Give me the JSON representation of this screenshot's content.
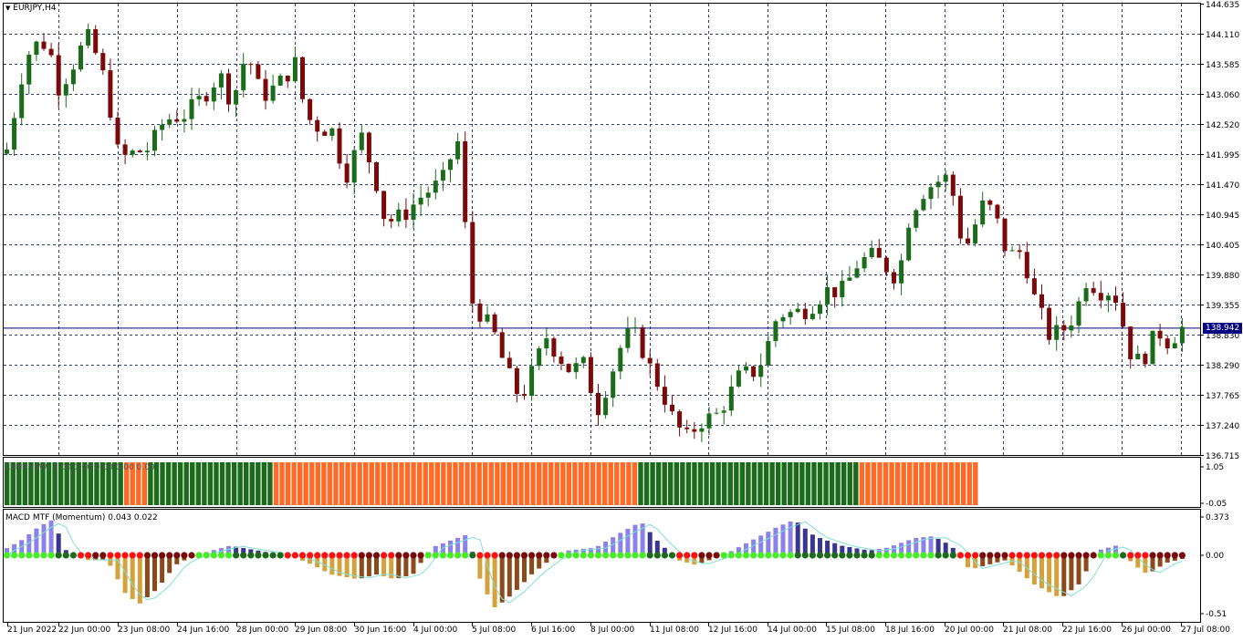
{
  "window": {
    "symbol_title": "EURJPY,H4",
    "menu_arrow_icon": "triangle-down-icon"
  },
  "colors": {
    "bull": "#1a6b1a",
    "bear": "#7a0a0a",
    "grid": "#2f3d6e",
    "bid_line": "#000080",
    "trend_green": "#1a6b1a",
    "trend_orange": "#ff6a26",
    "macd_pos_light": "#8a82e8",
    "macd_pos_dark": "#3a3590",
    "macd_neg_light": "#d4a23c",
    "macd_neg_dark": "#8a4a1a",
    "dot_bright_green": "#44ee22",
    "dot_dark_green": "#1a6b1a",
    "dot_red": "#ff1010",
    "dot_dark_red": "#7a0a0a",
    "signal_line": "#7fe0d0"
  },
  "price_axis": {
    "ticks": [
      "144.635",
      "144.110",
      "143.585",
      "143.060",
      "142.520",
      "141.995",
      "141.470",
      "140.945",
      "140.405",
      "139.880",
      "139.355",
      "138.830",
      "138.290",
      "137.765",
      "137.240",
      "136.715"
    ],
    "current_price": "138.942"
  },
  "time_axis": {
    "labels": [
      "21 Jun 2022",
      "22 Jun 00:00",
      "23 Jun 08:00",
      "24 Jun 16:00",
      "28 Jun 00:00",
      "29 Jun 08:00",
      "30 Jun 16:00",
      "4 Jul 00:00",
      "5 Jul 08:00",
      "6 Jul 16:00",
      "8 Jul 00:00",
      "11 Jul 08:00",
      "12 Jul 16:00",
      "14 Jul 00:00",
      "15 Jul 08:00",
      "18 Jul 16:00",
      "20 Jul 00:00",
      "21 Jul 08:00",
      "22 Jul 16:00",
      "26 Jul 00:00",
      "27 Jul 08:00"
    ]
  },
  "indicator1": {
    "label": "LSMA (SW) 1.00 1.00 0.00 0.00 0.00",
    "axis_ticks": [
      "1.05",
      "-0.05"
    ],
    "segments": [
      {
        "trend": "up",
        "bars": 20
      },
      {
        "trend": "down",
        "bars": 4
      },
      {
        "trend": "up",
        "bars": 21
      },
      {
        "trend": "down",
        "bars": 61
      },
      {
        "trend": "up",
        "bars": 37
      },
      {
        "trend": "down",
        "bars": 20
      }
    ]
  },
  "indicator2": {
    "label": "MACD MTF (Momentum) 0.043 0.022",
    "axis_ticks": [
      "0.373",
      "0.00",
      "-0.51"
    ]
  },
  "chart_data": {
    "type": "candlestick",
    "timeframe": "H4",
    "symbol": "EURJPY",
    "ylim": [
      136.715,
      144.635
    ],
    "candles": [
      [
        138.8,
        139.0,
        138.6,
        138.75
      ],
      [
        138.75,
        138.85,
        138.4,
        138.5
      ],
      [
        138.5,
        138.7,
        138.4,
        138.65
      ],
      [
        138.65,
        139.2,
        138.55,
        139.1
      ],
      [
        139.1,
        139.3,
        138.9,
        138.98
      ],
      [
        138.98,
        139.15,
        138.75,
        138.85
      ],
      [
        138.85,
        139.0,
        138.7,
        138.94
      ],
      [
        138.94,
        139.05,
        138.85,
        138.942
      ]
    ]
  }
}
